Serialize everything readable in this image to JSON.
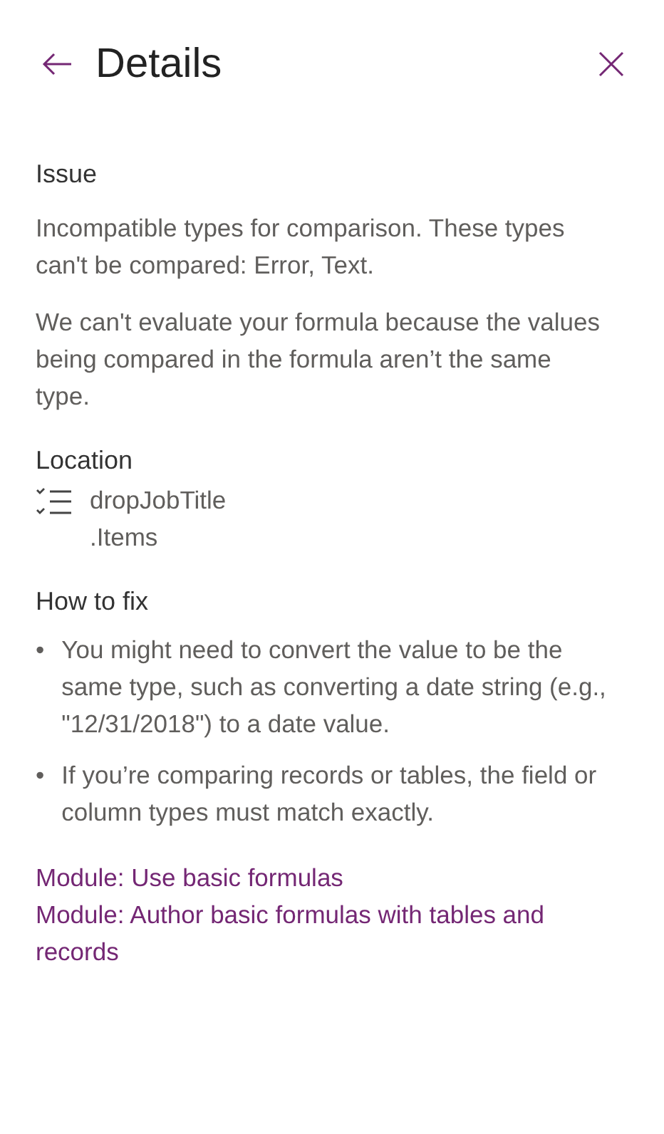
{
  "header": {
    "title": "Details"
  },
  "issue": {
    "heading": "Issue",
    "summary": "Incompatible types for comparison. These types can't be compared: Error, Text.",
    "explanation": "We can't evaluate your formula because the values being compared in the formula aren’t the same type."
  },
  "location": {
    "heading": "Location",
    "control": "dropJobTitle",
    "property": ".Items"
  },
  "fix": {
    "heading": "How to fix",
    "bullets": [
      {
        "marker": "•",
        "text": "You might need to convert the value to be the same type, such as converting a date string (e.g., \"12/31/2018\") to a date value."
      },
      {
        "marker": "•",
        "text": "If you’re comparing records or tables, the field or column types must match exactly."
      }
    ]
  },
  "links": [
    "Module: Use basic formulas",
    "Module: Author basic formulas with tables and records"
  ]
}
